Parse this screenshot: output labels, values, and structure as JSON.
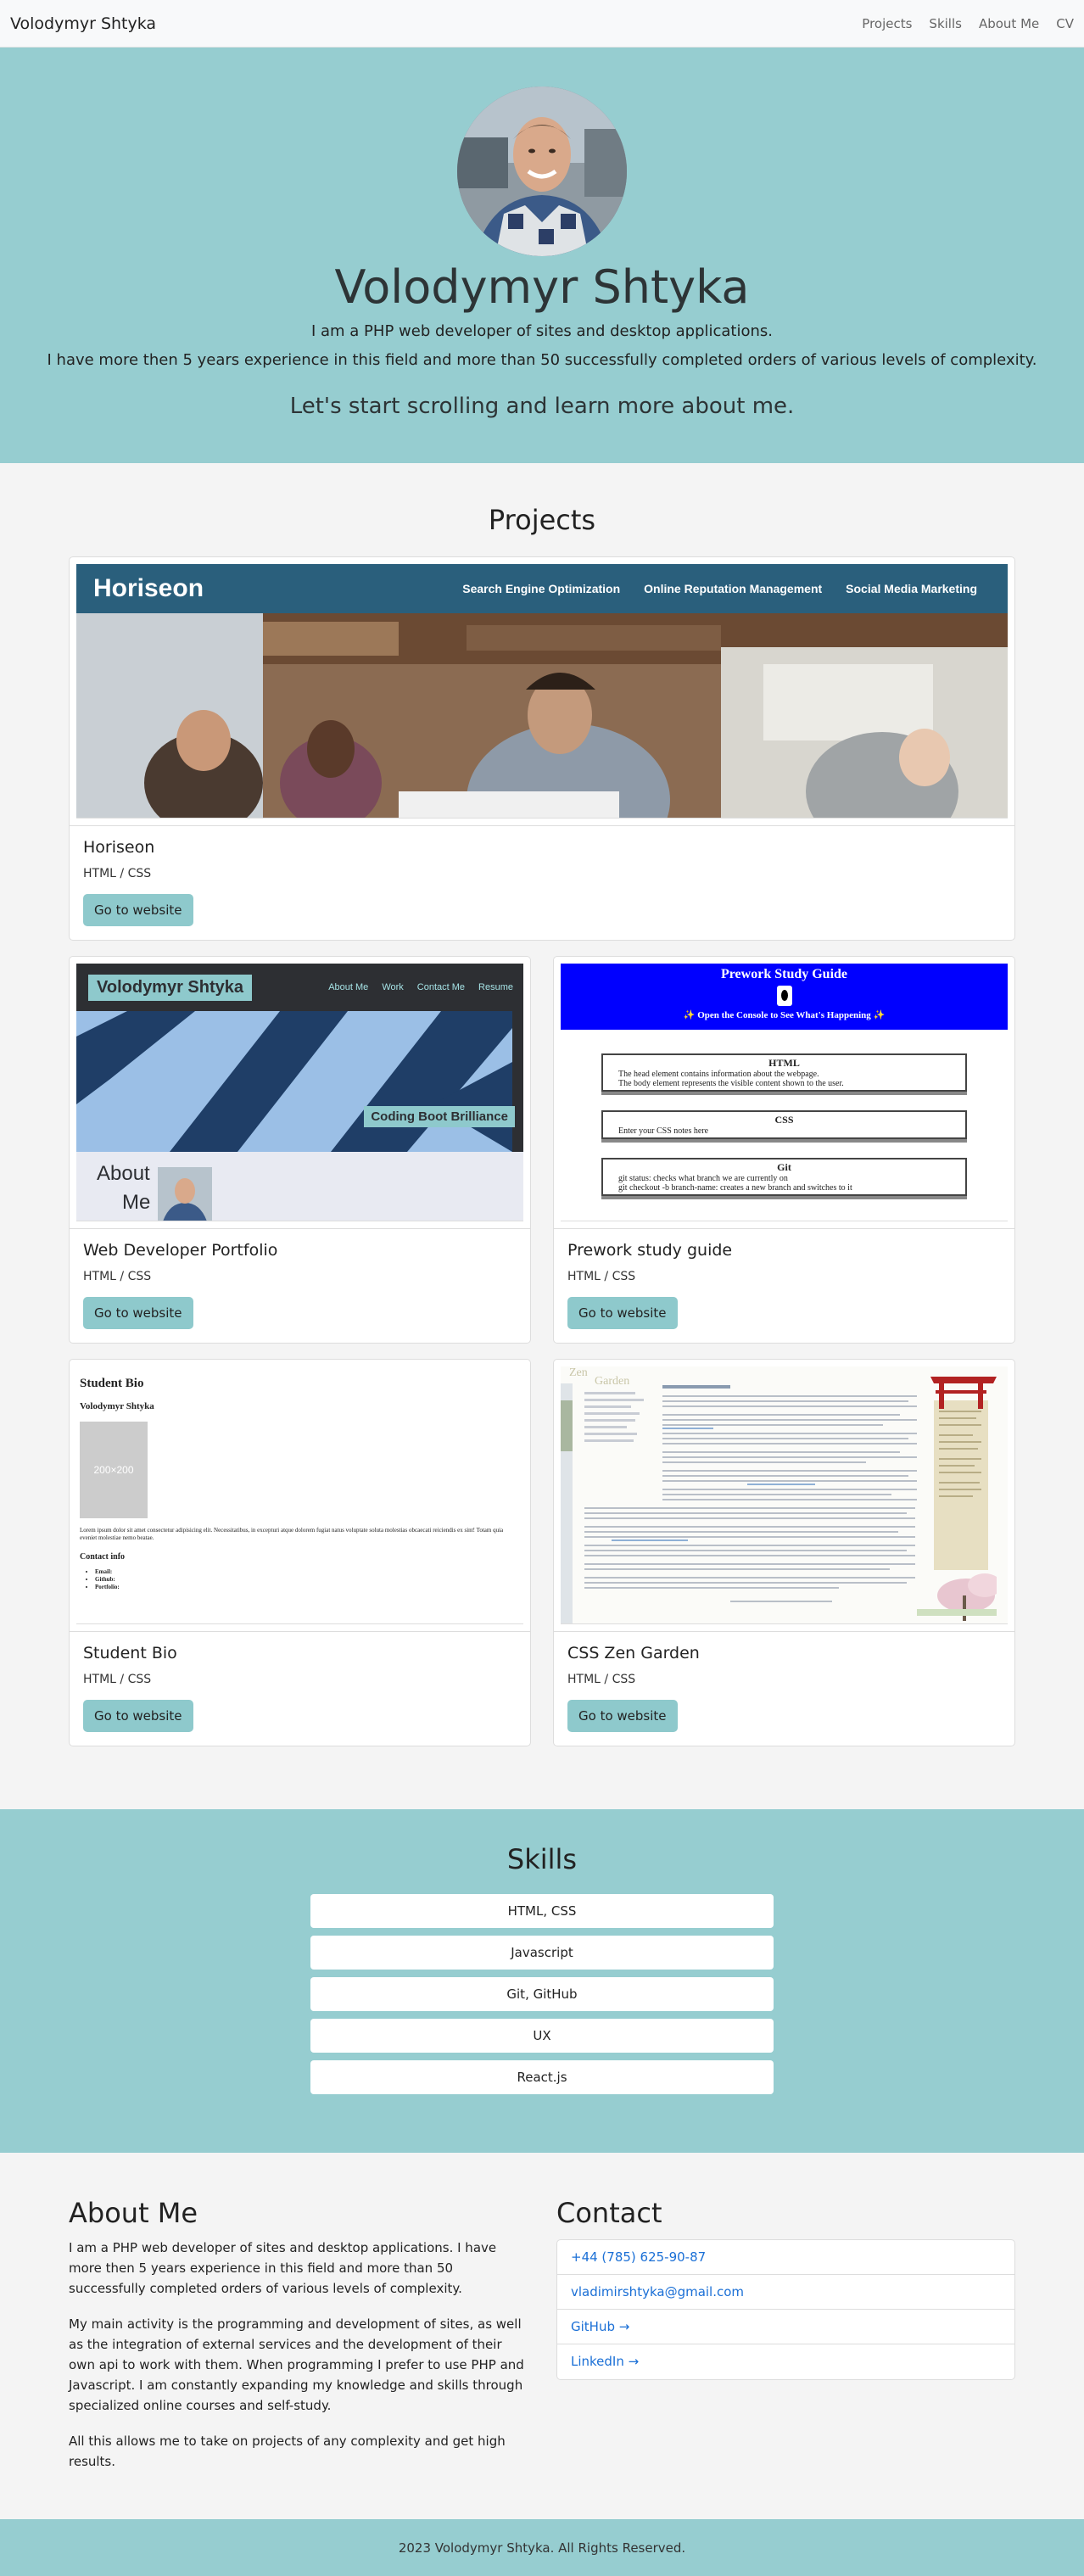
{
  "nav": {
    "brand": "Volodymyr Shtyka",
    "links": [
      "Projects",
      "Skills",
      "About Me",
      "CV"
    ]
  },
  "hero": {
    "name": "Volodymyr Shtyka",
    "line1": "I am a PHP web developer of sites and desktop applications.",
    "line2": "I have more then 5 years experience in this field and more than 50 successfully completed orders of various levels of complexity.",
    "cta": "Let's start scrolling and learn more about me."
  },
  "projects": {
    "title": "Projects",
    "button_label": "Go to website",
    "items": [
      {
        "title": "Horiseon",
        "tech": "HTML / CSS",
        "thumb_text": [
          "Horiseon",
          "Search Engine Optimization",
          "Online Reputation Management",
          "Social Media Marketing"
        ]
      },
      {
        "title": "Web Developer Portfolio",
        "tech": "HTML / CSS",
        "thumb_text": [
          "Volodymyr Shtyka",
          "About Me",
          "Work",
          "Contact Me",
          "Resume",
          "Coding Boot Brilliance",
          "About",
          "Me"
        ]
      },
      {
        "title": "Prework study guide",
        "tech": "HTML / CSS",
        "thumb_text": [
          "Prework Study Guide",
          "✨ Open the Console to See What's Happening ✨",
          "HTML",
          "The head element contains information about the webpage.",
          "The body element represents the visible content shown to the user.",
          "CSS",
          "Enter your CSS notes here",
          "Git",
          "git status: checks what branch we are currently on",
          "git checkout -b branch-name: creates a new branch and switches to it"
        ]
      },
      {
        "title": "Student Bio",
        "tech": "HTML / CSS",
        "thumb_text": [
          "Student Bio",
          "Volodymyr Shtyka",
          "200×200",
          "Lorem ipsum dolor sit amet consectetur adipisicing elit. Necessitatibus, in excepturi atque dolorem fugiat natus voluptate soluta molestias obcaecati reiciendis ex sint! Totam quia eveniet molestiae nemo beatae.",
          "Contact info",
          "Email:",
          "Github:",
          "Portfolio:"
        ]
      },
      {
        "title": "CSS Zen Garden",
        "tech": "HTML / CSS",
        "thumb_text": [
          "Zen",
          "Garden"
        ]
      }
    ]
  },
  "skills": {
    "title": "Skills",
    "items": [
      "HTML, CSS",
      "Javascript",
      "Git, GitHub",
      "UX",
      "React.js"
    ]
  },
  "about": {
    "title": "About Me",
    "p1": "I am a PHP web developer of sites and desktop applications. I have more then 5 years experience in this field and more than 50 successfully completed orders of various levels of complexity.",
    "p2": "My main activity is the programming and development of sites, as well as the integration of external services and the development of their own api to work with them. When programming I prefer to use PHP and Javascript. I am constantly expanding my knowledge and skills through specialized online courses and self-study.",
    "p3": "All this allows me to take on projects of any complexity and get high results."
  },
  "contact": {
    "title": "Contact",
    "phone": "+44 (785) 625-90-87",
    "email": "vladimirshtyka@gmail.com",
    "github": "GitHub",
    "linkedin": "LinkedIn",
    "arrow": "→"
  },
  "footer": {
    "text": "2023 Volodymyr Shtyka. All Rights Reserved."
  },
  "colors": {
    "accent": "#96cdd0",
    "button": "#8ec9cc",
    "link": "#1a6fd6"
  }
}
